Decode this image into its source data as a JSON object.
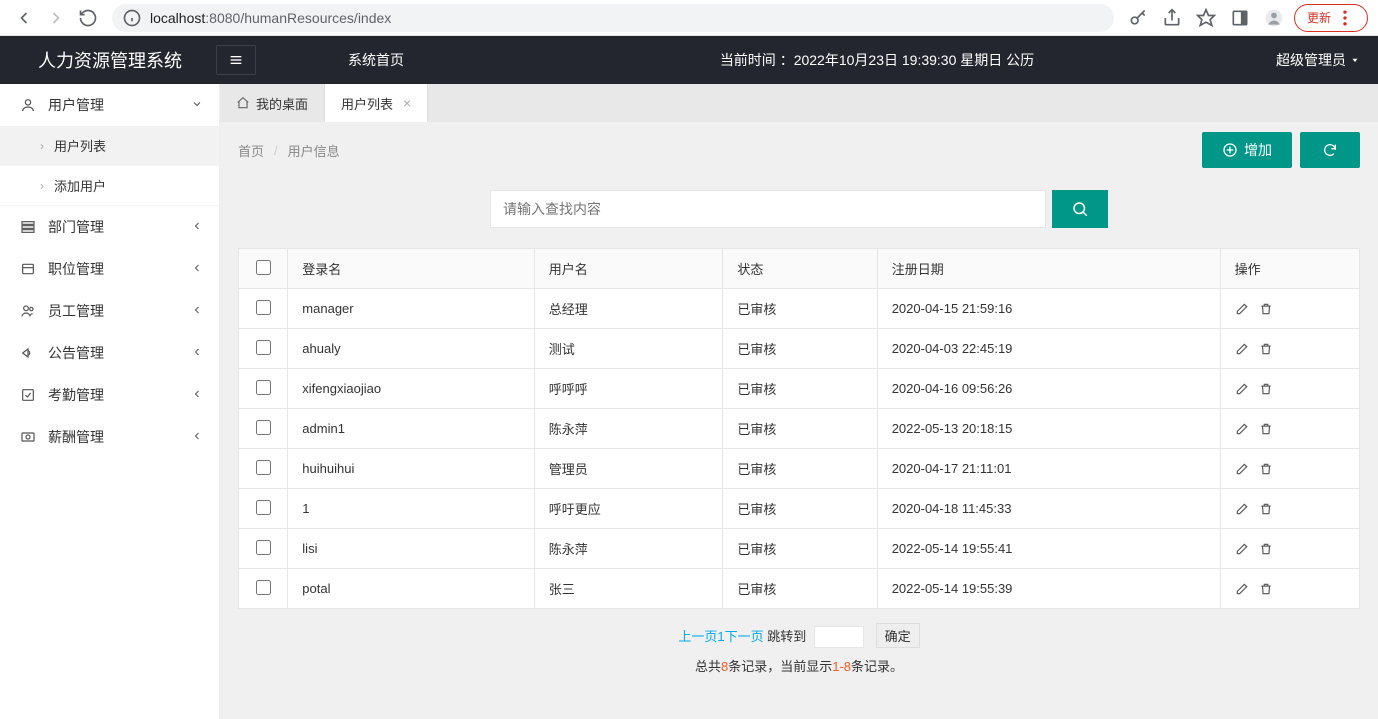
{
  "browser": {
    "url_host": "localhost",
    "url_port": ":8080",
    "url_path": "/humanResources/index",
    "update_label": "更新"
  },
  "topbar": {
    "brand": "人力资源管理系统",
    "home_label": "系统首页",
    "time_prefix": "当前时间 ：",
    "time_value": "2022年10月23日 19:39:30 星期日",
    "time_suffix": "  公历",
    "user_label": "超级管理员"
  },
  "sidebar": {
    "items": [
      {
        "label": "用户管理",
        "children": [
          {
            "label": "用户列表"
          },
          {
            "label": "添加用户"
          }
        ]
      },
      {
        "label": "部门管理"
      },
      {
        "label": "职位管理"
      },
      {
        "label": "员工管理"
      },
      {
        "label": "公告管理"
      },
      {
        "label": "考勤管理"
      },
      {
        "label": "薪酬管理"
      }
    ]
  },
  "tabs": {
    "home": "我的桌面",
    "active": "用户列表"
  },
  "breadcrumb": {
    "home": "首页",
    "current": "用户信息"
  },
  "actions": {
    "add_label": "增加"
  },
  "search": {
    "placeholder": "请输入查找内容"
  },
  "table": {
    "headers": {
      "login": "登录名",
      "username": "用户名",
      "status": "状态",
      "date": "注册日期",
      "ops": "操作"
    },
    "rows": [
      {
        "login": "manager",
        "username": "总经理",
        "status": "已审核",
        "date": "2020-04-15 21:59:16"
      },
      {
        "login": "ahualy",
        "username": "测试",
        "status": "已审核",
        "date": "2020-04-03 22:45:19"
      },
      {
        "login": "xifengxiaojiao",
        "username": "呼呼呼",
        "status": "已审核",
        "date": "2020-04-16 09:56:26"
      },
      {
        "login": "admin1",
        "username": "陈永萍",
        "status": "已审核",
        "date": "2022-05-13 20:18:15"
      },
      {
        "login": "huihuihui",
        "username": "管理员",
        "status": "已审核",
        "date": "2020-04-17 21:11:01"
      },
      {
        "login": "1",
        "username": "呼吁更应",
        "status": "已审核",
        "date": "2020-04-18 11:45:33"
      },
      {
        "login": "lisi",
        "username": "陈永萍",
        "status": "已审核",
        "date": "2022-05-14 19:55:41"
      },
      {
        "login": "potal",
        "username": "张三",
        "status": "已审核",
        "date": "2022-05-14 19:55:39"
      }
    ]
  },
  "pager": {
    "prev": "上一页",
    "page": "1",
    "next": "下一页",
    "jump_label": "跳转到",
    "confirm": "确定",
    "summary_prefix": "总共",
    "summary_total": "8",
    "summary_mid": "条记录，当前显示",
    "summary_range": "1-8",
    "summary_suffix": "条记录。"
  }
}
